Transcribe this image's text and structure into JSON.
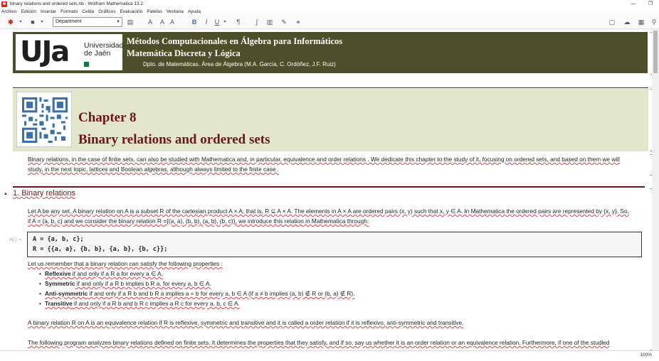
{
  "window": {
    "title": "binary relations and ordered sets.nb - Wolfram Mathematica 13.2",
    "app_icon": "mathematica-icon"
  },
  "menu": [
    "Archivo",
    "Edición",
    "Insertar",
    "Formato",
    "Celda",
    "Gráficos",
    "Evaluación",
    "Paletas",
    "Ventana",
    "Ayuda"
  ],
  "toolbar": {
    "style_value": "Department",
    "bold": "B",
    "italic": "I",
    "underline": "U"
  },
  "banner": {
    "logo_text": "UJa",
    "logo_sub_1": "Universidad",
    "logo_sub_2": "de Jaén",
    "line1": "Métodos Computacionales en Álgebra para Informáticos",
    "line2": "Matemática Discreta y Lógica",
    "line3": "Dpto. de Matemáticas. Área de Álgebra (M.A. García, C. Ordóñez, J.F. Ruiz)"
  },
  "chapter": {
    "number": "Chapter 8",
    "title": "Binary relations and ordered sets"
  },
  "intro": {
    "line1": "Binary relations, in the case of finite sets, can also be studied with Mathematica and, in particular, equivalence and order relations . We dedicate this chapter to the study of it, focusing on ordered sets, and based on them we will",
    "line2": "study, in the next topic, lattices and Boolean algebras, although always limited to the finite case ."
  },
  "section": {
    "title": "1. Binary relations"
  },
  "def_para": {
    "line1": "Let A be any set. A binary relation on A is a subset R of the cartesian product A × A, that is, R ⊆ A × A. The elements in A × A are ordered pairs (x, y) such that x, y ∈ A. In Mathematica the ordered pairs are represented by {x, y}. So,",
    "line2": "if A = {a, b, c} and we consider the binary relation R ={(a, a), (b, b), (a, b), (b, c)}, we introduce this  relation in Mathematica through:"
  },
  "input_cell": {
    "label": "In[ ] :=",
    "line1": "A = {a, b, c};",
    "line2": "R = {{a, a}, {b, b}, {a, b}, {b, c}};"
  },
  "props_intro": "Let us remember that a binary relation can satisfy the following properties :",
  "properties": [
    {
      "name": "Reflexive",
      "text": " if and only if a R a for every a ∈ A."
    },
    {
      "name": "Symmetric",
      "text": " if and only if a R b implies b R a, for every a, b ∈ A."
    },
    {
      "name": "Anti-symmetric",
      "text": " if and only if a R b and b R a implies a = b for every a, b ∈ A (if a ≠ b  implies  (a, b) ∉ R or (b, a) ∉ R)."
    },
    {
      "name": "Transitive",
      "text": " if and only if a R b and b R c implies a R c for every a, b, c ∈ A."
    }
  ],
  "equiv_para": "A binary relation R on A is an equivalence relation if R is reflexive, symmetric and transitive and it is called a order relation if it is reflexivo, anti-symmetric and transitive.",
  "program_para": "The following program analyzes binary relations defined on finite sets. It determines the properties that they satisfy, and if so, say us whether it is an order relation or an equivalence relation. Furthermore, if one of the studied",
  "status": {
    "zoom": "100%"
  },
  "colors": {
    "banner_bg": "#4e4e2a",
    "chapter_bg": "#e4e6cc",
    "chapter_text": "#6b1717"
  }
}
